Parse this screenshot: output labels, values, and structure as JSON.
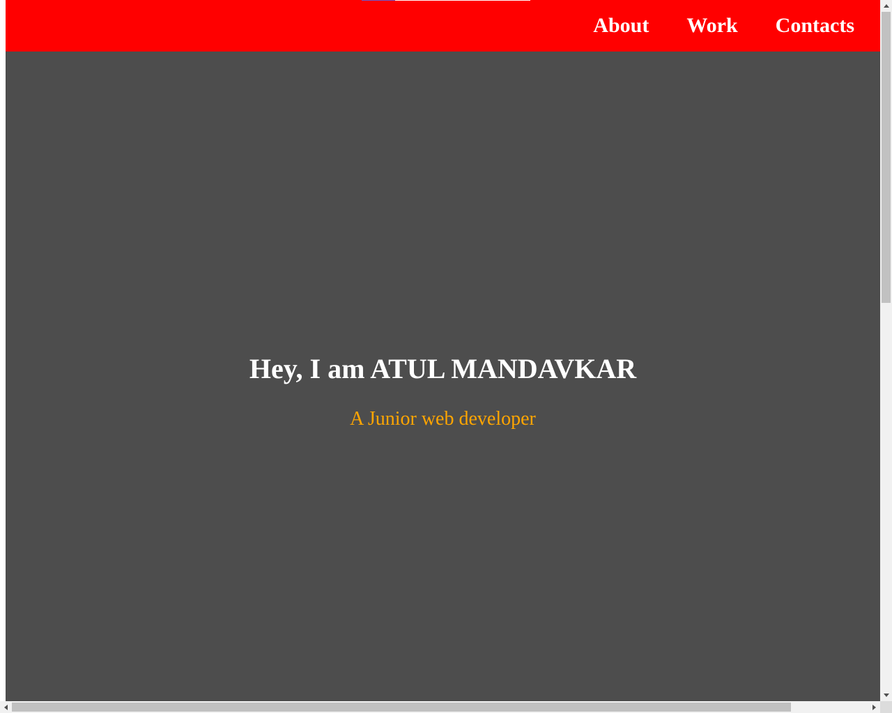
{
  "nav": {
    "items": [
      {
        "label": "About"
      },
      {
        "label": "Work"
      },
      {
        "label": "Contacts"
      }
    ]
  },
  "hero": {
    "title": "Hey, I am ATUL MANDAVKAR",
    "subtitle": "A Junior web developer"
  },
  "colors": {
    "navbar": "#ff0000",
    "hero_bg": "#4d4d4d",
    "title": "#ffffff",
    "subtitle": "#ffa500"
  },
  "icons": {
    "scroll_up": "arrow-up-icon",
    "scroll_down": "arrow-down-icon",
    "scroll_left": "arrow-left-icon",
    "scroll_right": "arrow-right-icon"
  }
}
